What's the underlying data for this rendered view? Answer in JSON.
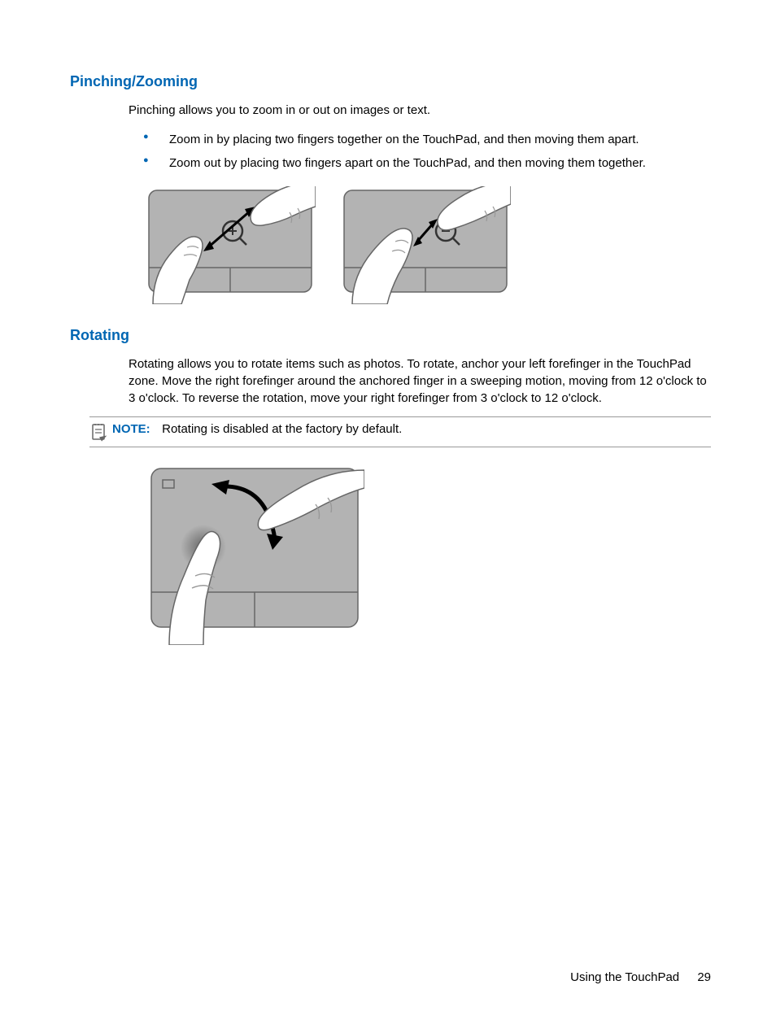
{
  "section1": {
    "heading": "Pinching/Zooming",
    "intro": "Pinching allows you to zoom in or out on images or text.",
    "bullets": [
      "Zoom in by placing two fingers together on the TouchPad, and then moving them apart.",
      "Zoom out by placing two fingers apart on the TouchPad, and then moving them together."
    ]
  },
  "section2": {
    "heading": "Rotating",
    "body": "Rotating allows you to rotate items such as photos. To rotate, anchor your left forefinger in the TouchPad zone. Move the right forefinger around the anchored finger in a sweeping motion, moving from 12 o'clock to 3 o'clock. To reverse the rotation, move your right forefinger from 3 o'clock to 12 o'clock.",
    "note_label": "NOTE:",
    "note_text": "Rotating is disabled at the factory by default."
  },
  "footer": {
    "title": "Using the TouchPad",
    "page": "29"
  }
}
